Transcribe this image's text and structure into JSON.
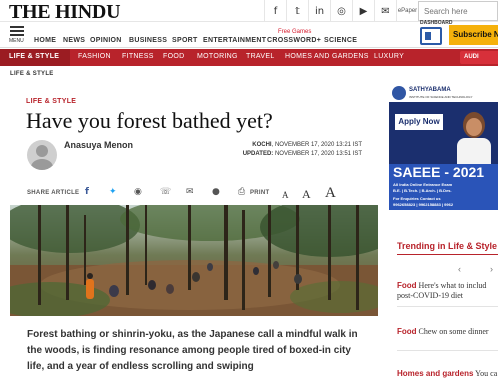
{
  "header": {
    "logo": "THE HINDU",
    "social_icons": [
      "facebook-icon",
      "twitter-icon",
      "linkedin-icon",
      "instagram-icon",
      "youtube-icon",
      "mail-icon"
    ],
    "epaper_label": "ePaper",
    "search_placeholder": "Search here"
  },
  "nav": {
    "menu_label": "MENU",
    "items": [
      "HOME",
      "NEWS",
      "OPINION",
      "BUSINESS",
      "SPORT",
      "ENTERTAINMENT",
      "CROSSWORD+",
      "SCIENCE"
    ],
    "free_games": "Free Games",
    "dashboard_label": "DASHBOARD",
    "subscribe_label": "Subscribe N"
  },
  "sections": {
    "items": [
      "LIFE & STYLE",
      "FASHION",
      "FITNESS",
      "FOOD",
      "MOTORING",
      "TRAVEL",
      "HOMES AND GARDENS",
      "LUXURY"
    ],
    "audio_label": "AUDI"
  },
  "breadcrumb": "LIFE & STYLE",
  "article": {
    "section": "LIFE & STYLE",
    "title": "Have you forest bathed yet?",
    "author": "Anasuya Menon",
    "location": "KOCHI",
    "published": ", NOVEMBER 17, 2020 13:21 IST",
    "updated_label": "UPDATED:",
    "updated": "NOVEMBER 17, 2020 13:51 IST",
    "share_label": "SHARE ARTICLE",
    "print_label": "PRINT",
    "font_sizes": [
      "A",
      "A",
      "A"
    ],
    "intro": "Forest bathing or shinrin-yoku, as the Japanese call a mindful walk in the woods, is finding resonance among people tired of boxed-in city life, and a year of endless scrolling and swiping"
  },
  "ad": {
    "name": "SATHYABAMA",
    "tagline": "INSTITUTE OF SCIENCE AND TECHNOLOGY",
    "apply_label": "Apply Now",
    "exam": "SAEEE - 2021",
    "line1": "All India Online Entrance Exam",
    "line2": "B.E. | B.Tech. | B.Arch. | B.Des.",
    "line3": "For Enquiries Contact us",
    "line4": "9962658823 | 9962158883 | 9962"
  },
  "trending": {
    "title": "Trending in Life & Style",
    "items": [
      {
        "category": "Food",
        "text": "Here's what to includ post-COVID-19 diet"
      },
      {
        "category": "Food",
        "text": "Chew on some dinner"
      },
      {
        "category": "Homes and gardens",
        "text": "You ca"
      }
    ]
  },
  "colors": {
    "brand_red": "#b8232b",
    "subscribe_yellow": "#f5b10b",
    "ad_blue": "#1b2f6e"
  }
}
